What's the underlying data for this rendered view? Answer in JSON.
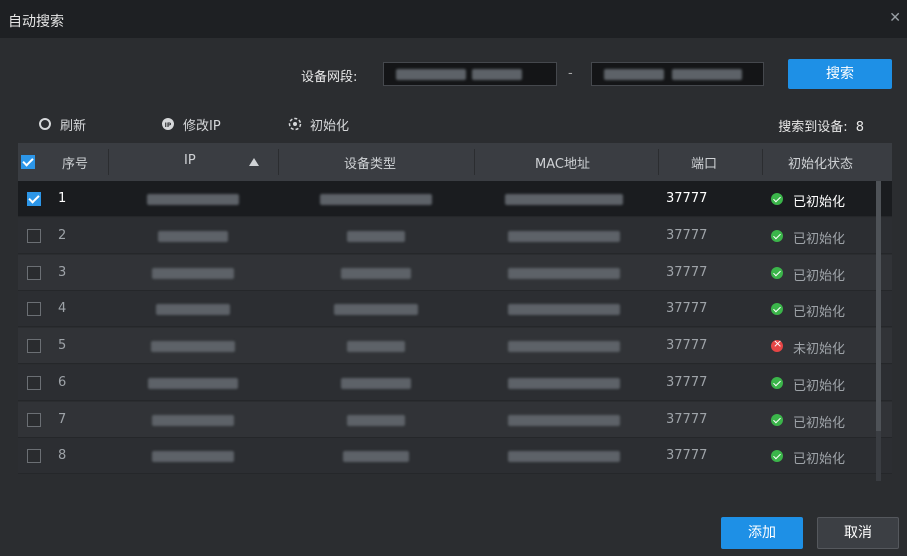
{
  "window": {
    "title": "自动搜索"
  },
  "search": {
    "segment_label": "设备网段:",
    "dash": "-",
    "button_label": "搜索"
  },
  "toolbar": {
    "refresh": "刷新",
    "modify_ip": "修改IP",
    "initialize": "初始化"
  },
  "summary": {
    "found_label": "搜索到设备:",
    "found_count": "8"
  },
  "table": {
    "headers": {
      "index": "序号",
      "ip": "IP",
      "type": "设备类型",
      "mac": "MAC地址",
      "port": "端口",
      "status": "初始化状态"
    },
    "rows": [
      {
        "index": "1",
        "port": "37777",
        "status": "已初始化",
        "status_kind": "ok",
        "selected": true
      },
      {
        "index": "2",
        "port": "37777",
        "status": "已初始化",
        "status_kind": "ok",
        "selected": false
      },
      {
        "index": "3",
        "port": "37777",
        "status": "已初始化",
        "status_kind": "ok",
        "selected": false
      },
      {
        "index": "4",
        "port": "37777",
        "status": "已初始化",
        "status_kind": "ok",
        "selected": false
      },
      {
        "index": "5",
        "port": "37777",
        "status": "未初始化",
        "status_kind": "error",
        "selected": false
      },
      {
        "index": "6",
        "port": "37777",
        "status": "已初始化",
        "status_kind": "ok",
        "selected": false
      },
      {
        "index": "7",
        "port": "37777",
        "status": "已初始化",
        "status_kind": "ok",
        "selected": false
      },
      {
        "index": "8",
        "port": "37777",
        "status": "已初始化",
        "status_kind": "ok",
        "selected": false
      }
    ]
  },
  "footer": {
    "add_label": "添加",
    "cancel_label": "取消"
  },
  "colors": {
    "accent": "#1e90e6",
    "ok": "#3bb54a",
    "error": "#e64545"
  }
}
